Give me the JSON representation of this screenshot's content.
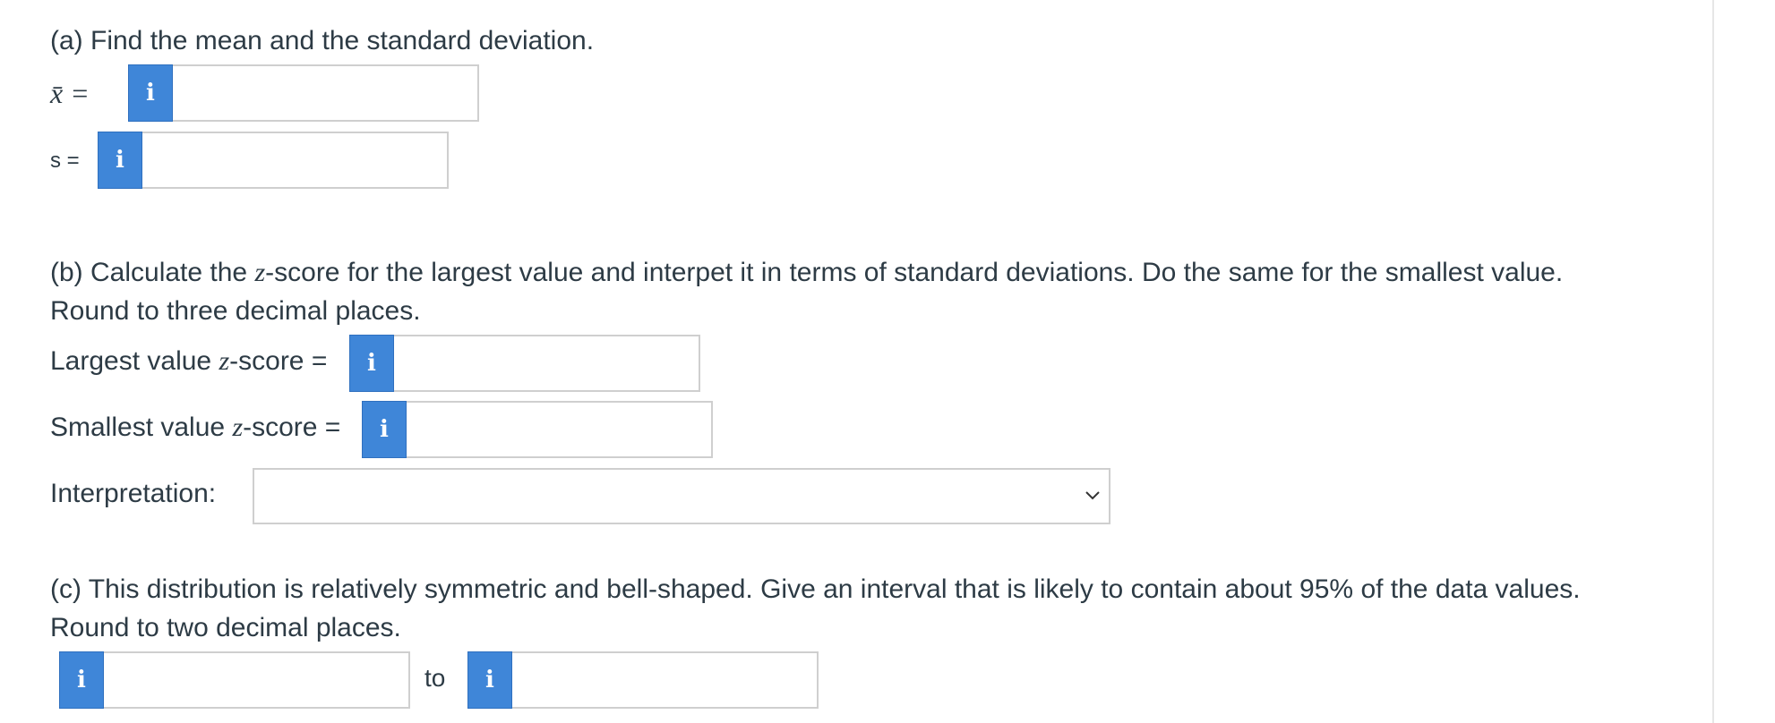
{
  "part_a": {
    "heading": "(a) Find the mean and the standard deviation.",
    "mean_label": "x̄ =",
    "sd_label": "s =",
    "mean_value": "",
    "sd_value": ""
  },
  "part_b": {
    "heading_prefix": "(b) Calculate the ",
    "heading_z": "z",
    "heading_suffix": "-score for the largest value and interpet it in terms of standard deviations. Do the same for the smallest value.",
    "round_note": "Round to three decimal places.",
    "largest_prefix": "Largest value ",
    "largest_z": "z",
    "largest_suffix": "-score =",
    "smallest_prefix": "Smallest value ",
    "smallest_z": "z",
    "smallest_suffix": "-score =",
    "largest_value": "",
    "smallest_value": "",
    "interpretation_label": "Interpretation:",
    "interpretation_selected": ""
  },
  "part_c": {
    "heading": "(c) This distribution is relatively symmetric and bell-shaped. Give an interval that is likely to contain about 95% of the data values.",
    "round_note": "Round to two decimal places.",
    "to_label": "to",
    "lower_value": "",
    "upper_value": ""
  },
  "info_icon_glyph": "i",
  "colors": {
    "info_button": "#3f86d8",
    "text": "#2d3b45",
    "border": "#cfcfcf"
  }
}
